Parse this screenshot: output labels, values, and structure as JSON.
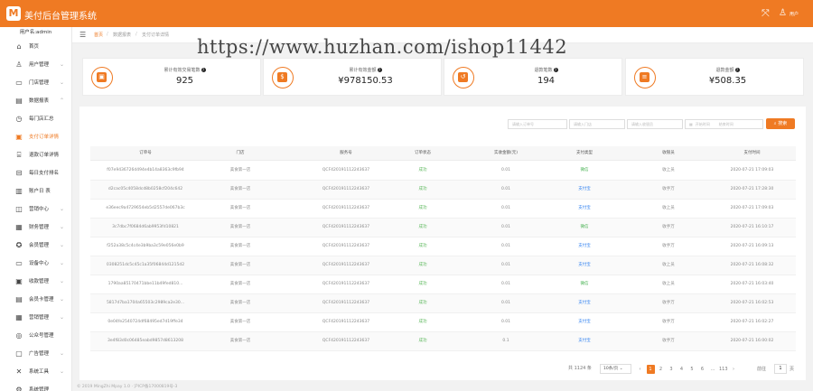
{
  "app": {
    "title": "美付后台管理系统",
    "logo_letter": "M",
    "user_label": "用户"
  },
  "sidebar": {
    "user": "用户名:admin",
    "items": [
      {
        "label": "首页",
        "icon": "home-icon",
        "glyph": "⌂",
        "chev": ""
      },
      {
        "label": "用户管理",
        "icon": "user-icon",
        "glyph": "♙",
        "chev": "⌄"
      },
      {
        "label": "门店管理",
        "icon": "store-icon",
        "glyph": "▭",
        "chev": "⌄"
      },
      {
        "label": "数据报表",
        "icon": "report-icon",
        "glyph": "▤",
        "chev": "⌃"
      },
      {
        "label": "每门店汇总",
        "icon": "clock-icon",
        "glyph": "◷",
        "chev": ""
      },
      {
        "label": "支付订单详情",
        "icon": "order-icon",
        "glyph": "▣",
        "chev": ""
      },
      {
        "label": "退款订单详情",
        "icon": "refund-icon",
        "glyph": "⌸",
        "chev": ""
      },
      {
        "label": "每日支付排名",
        "icon": "rank-icon",
        "glyph": "⊟",
        "chev": ""
      },
      {
        "label": "账户日 表",
        "icon": "bar-icon",
        "glyph": "▥",
        "chev": ""
      },
      {
        "label": "营销中心",
        "icon": "marketing-icon",
        "glyph": "◫",
        "chev": "⌄"
      },
      {
        "label": "财务管理",
        "icon": "finance-icon",
        "glyph": "▦",
        "chev": "⌄"
      },
      {
        "label": "会员管理",
        "icon": "member-icon",
        "glyph": "✪",
        "chev": "⌄"
      },
      {
        "label": "设备中心",
        "icon": "device-icon",
        "glyph": "▭",
        "chev": "⌄"
      },
      {
        "label": "收款管理",
        "icon": "receive-icon",
        "glyph": "▣",
        "chev": "⌄"
      },
      {
        "label": "会员卡管理",
        "icon": "card-icon",
        "glyph": "▤",
        "chev": "⌄"
      },
      {
        "label": "营销管理",
        "icon": "promo-icon",
        "glyph": "▦",
        "chev": "⌄"
      },
      {
        "label": "公众号管理",
        "icon": "wechat-icon",
        "glyph": "◎",
        "chev": ""
      },
      {
        "label": "广告管理",
        "icon": "ad-icon",
        "glyph": "▢",
        "chev": "⌄"
      },
      {
        "label": "系统工具",
        "icon": "tools-icon",
        "glyph": "✕",
        "chev": "⌄"
      },
      {
        "label": "系统管理",
        "icon": "settings-icon",
        "glyph": "⚙",
        "chev": ""
      }
    ]
  },
  "breadcrumb": {
    "home": "首页",
    "level2": "数据报表",
    "level3": "支付订单详情",
    "sep": "/"
  },
  "watermark": "https://www.huzhan.com/ishop11442",
  "stats": [
    {
      "label": "累计有效交易笔数",
      "value": "925",
      "icon": "order-count-icon",
      "glyph": "▣"
    },
    {
      "label": "累计有效金额",
      "value": "¥978150.53",
      "icon": "money-bag-icon",
      "glyph": "$"
    },
    {
      "label": "退款笔数",
      "value": "194",
      "icon": "refund-count-icon",
      "glyph": "↺"
    },
    {
      "label": "退款金额",
      "value": "¥508.35",
      "icon": "coins-icon",
      "glyph": "≡"
    }
  ],
  "filters": {
    "order_no_placeholder": "请输入订单号",
    "store_placeholder": "请输入门店",
    "cashier_placeholder": "请输入收银员",
    "start_placeholder": "开始时间",
    "end_placeholder": "结束时间",
    "search_label": "搜索"
  },
  "table": {
    "headers": [
      "订单号",
      "门店",
      "服务号",
      "订单状态",
      "实收金额(元)",
      "支付类型",
      "收银员",
      "支付时间"
    ],
    "rows": [
      [
        "f07e9436726d494e4b14a8363c9fb94",
        "美食第一店",
        "QCF420191112243637",
        "成功",
        "0.01",
        "微信",
        "收上员",
        "2020-07-21 17:09:03"
      ],
      [
        "d2cac05c4058dcd8b0258cf204c642",
        "美食第一店",
        "QCF420191112243637",
        "成功",
        "0.01",
        "支付宝",
        "收手万",
        "2020-07-21 17:28:30"
      ],
      [
        "e36eec9a4729654eb5d2557de067b3c",
        "美食第一店",
        "QCF420191112243637",
        "成功",
        "0.01",
        "支付宝",
        "收上员",
        "2020-07-21 17:09:03"
      ],
      [
        "3c7dbc7f0684d6ab9953fd10821",
        "美食第一店",
        "QCF420191112243637",
        "成功",
        "0.01",
        "微信",
        "收手万",
        "2020-07-21 16:10:17"
      ],
      [
        "f252a38c5c4c4e3b9ba3c59e056e0b9",
        "美食第一店",
        "QCF420191112243637",
        "成功",
        "0.01",
        "支付宝",
        "收手万",
        "2020-07-21 16:09:13"
      ],
      [
        "0308251dc5c45c1a35f06844d1215d2",
        "美食第一店",
        "QCF420191112243637",
        "成功",
        "0.01",
        "支付宝",
        "收上员",
        "2020-07-21 16:08:32"
      ],
      [
        "1790aa85170471bbe11b49fed810...",
        "美食第一店",
        "QCF420191112243637",
        "成功",
        "0.01",
        "微信",
        "收上员",
        "2020-07-21 16:03:40"
      ],
      [
        "5817d7ba1704a65503c2989ca2e30...",
        "美食第一店",
        "QCF420191112243637",
        "成功",
        "0.01",
        "支付宝",
        "收手万",
        "2020-07-21 16:02:53"
      ],
      [
        "0e04fe2540724df68495ed7d19ffe34",
        "美食第一店",
        "QCF420191112243637",
        "成功",
        "0.01",
        "支付宝",
        "收手万",
        "2020-07-21 16:02:27"
      ],
      [
        "3e4f83d0c06485eabd9857d8613208",
        "美食第一店",
        "QCF420191112243637",
        "成功",
        "0.1",
        "支付宝",
        "收手万",
        "2020-07-21 16:00:02"
      ]
    ]
  },
  "pagination": {
    "total": "共 1124 条",
    "page_size": "10条/页",
    "prev": "‹",
    "pages": [
      "1",
      "2",
      "3",
      "4",
      "5",
      "6",
      "...",
      "113"
    ],
    "next": "›",
    "goto_label": "前往",
    "goto_value": "1",
    "page_suffix": "页"
  },
  "footer": "© 2019 MingZhi Mpay 1.0 · 沪ICP备17000819号-3"
}
